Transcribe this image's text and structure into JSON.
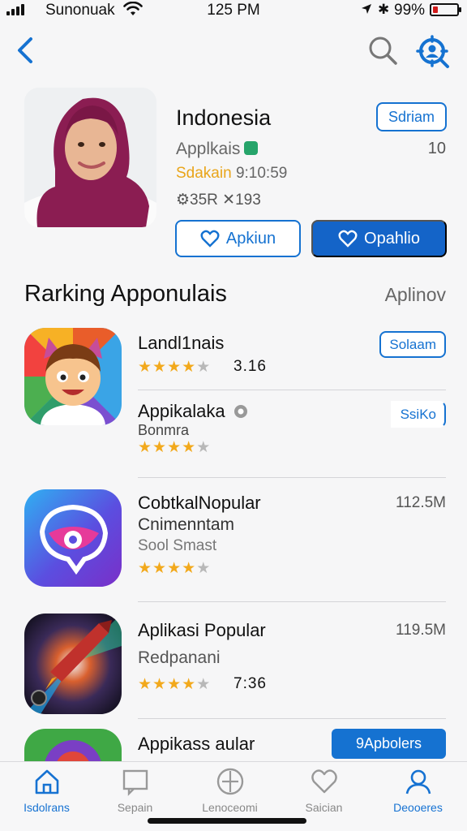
{
  "status_bar": {
    "carrier": "Sunonuak",
    "time": "125 PM",
    "bluetooth": "✱",
    "battery_percent": "99%",
    "battery_level": 0.2
  },
  "nav": {
    "back_icon": "chevron-left-icon",
    "search_icon": "search-icon",
    "profile_icon": "profile-search-icon"
  },
  "featured": {
    "title": "Indonesia",
    "subtitle": "Applkais",
    "count": "10",
    "meta_label": "Sdakain",
    "meta_value": "9:10:59",
    "stats": "⚙35R ✕193",
    "small_button": "Sdriam",
    "button_outline": "Apkiun",
    "button_filled": "Opahlio"
  },
  "section": {
    "title": "Rarking Apponulais",
    "link": "Aplinov"
  },
  "rows": [
    {
      "title": "Landl1nais",
      "rating_text": "3.16",
      "rating": 4,
      "button": "Solaam"
    },
    {
      "title": "Appikalaka",
      "line2": "Bonmra",
      "rating": 4,
      "button": "SsiKo"
    },
    {
      "title": "CobtkalNopular",
      "line2": "Cnimenntam",
      "line3": "Sool Smast",
      "rating": 4,
      "size": "112.5M"
    },
    {
      "title": "Aplikasi Popular",
      "line2": "Redpanani",
      "rating_text": "7:36",
      "rating": 4,
      "size": "119.5M"
    },
    {
      "title": "Appikass aular",
      "button": "9Apbolers"
    }
  ],
  "tabs": [
    {
      "label": "Isdolrans",
      "icon": "home-icon",
      "active": true
    },
    {
      "label": "Sepain",
      "icon": "message-icon",
      "active": false
    },
    {
      "label": "Lenoceomi",
      "icon": "compass-icon",
      "active": false
    },
    {
      "label": "Saician",
      "icon": "heart-icon",
      "active": false
    },
    {
      "label": "Deooeres",
      "icon": "person-icon",
      "active": true
    }
  ],
  "colors": {
    "accent": "#1572d1",
    "star": "#f2a91c",
    "meta_orange": "#e9a51a"
  }
}
